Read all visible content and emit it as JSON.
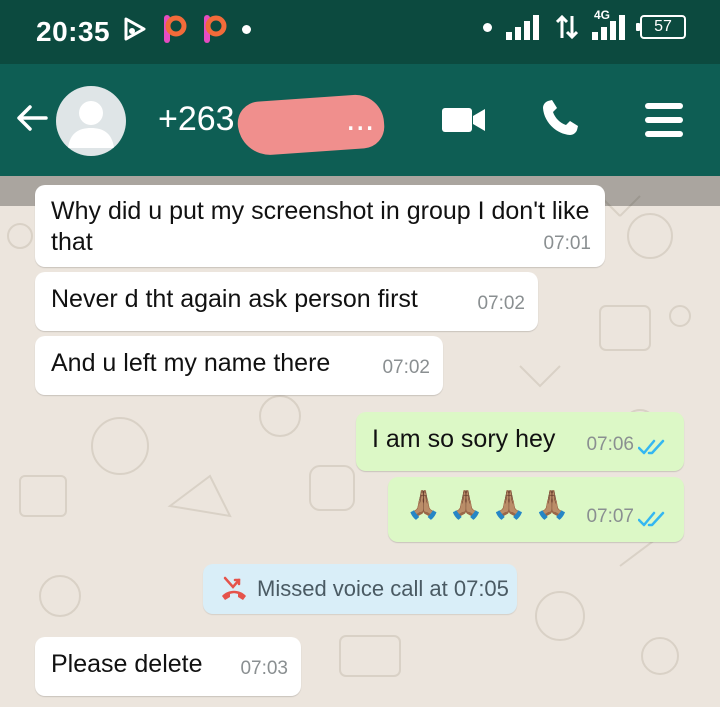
{
  "status_bar": {
    "time": "20:35",
    "network": "4G",
    "battery": "57"
  },
  "header": {
    "contact_name": "+263 7",
    "contact_suffix": "...",
    "icons": [
      "back-arrow-icon",
      "avatar",
      "video-call-icon",
      "voice-call-icon",
      "menu-icon"
    ]
  },
  "messages": [
    {
      "direction": "in",
      "text": "Why did u put my screenshot in group I don't like that",
      "time": "07:01"
    },
    {
      "direction": "in",
      "text": "Never d tht again ask person first",
      "time": "07:02"
    },
    {
      "direction": "in",
      "text": "And u left my name there",
      "time": "07:02"
    },
    {
      "direction": "out",
      "text": "I am so sory hey",
      "time": "07:06",
      "status": "read"
    },
    {
      "direction": "out",
      "text": "🙏🏽🙏🏽🙏🏽🙏🏽",
      "time": "07:07",
      "status": "read"
    },
    {
      "direction": "in",
      "text": "Please delete",
      "time": "07:03"
    }
  ],
  "system_message": {
    "text": "Missed voice call at 07:05",
    "icon": "missed-call-icon"
  },
  "colors": {
    "header": "#0e5e54",
    "status_bar": "#0c4a3f",
    "outgoing_bubble": "#dcf8c6",
    "incoming_bubble": "#ffffff",
    "read_ticks": "#34b7f1",
    "missed_call": "#e5534b"
  }
}
